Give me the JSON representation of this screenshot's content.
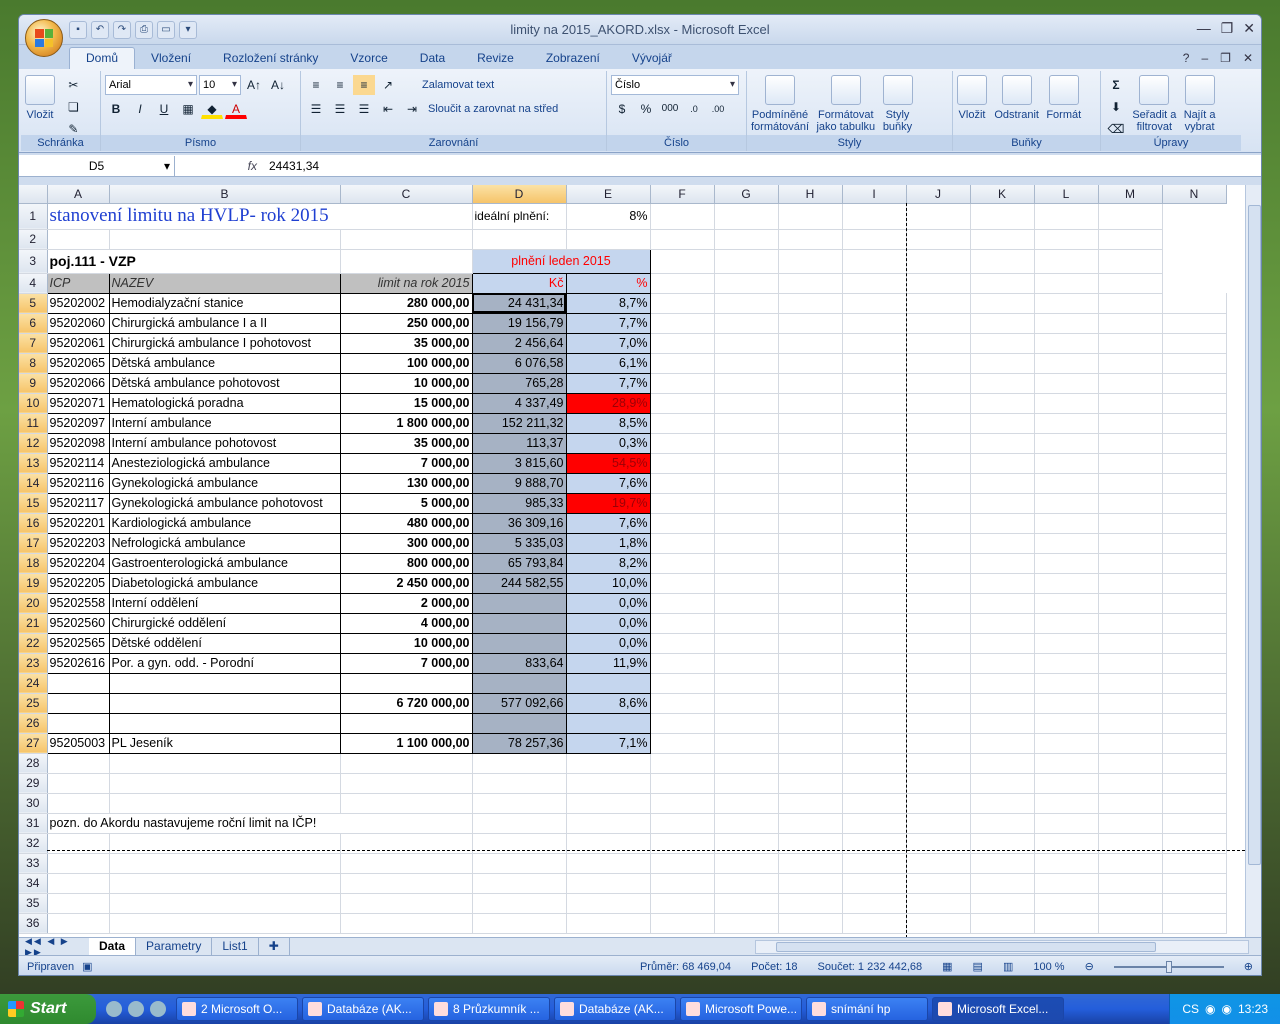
{
  "window": {
    "title": "limity na 2015_AKORD.xlsx - Microsoft Excel"
  },
  "ribbon_tabs": [
    "Domů",
    "Vložení",
    "Rozložení stránky",
    "Vzorce",
    "Data",
    "Revize",
    "Zobrazení",
    "Vývojář"
  ],
  "ribbon": {
    "clipboard": {
      "paste": "Vložit",
      "label": "Schránka"
    },
    "font": {
      "name": "Arial",
      "size": "10",
      "label": "Písmo",
      "bold": "B",
      "italic": "I",
      "underline": "U"
    },
    "alignment": {
      "wrap": "Zalamovat text",
      "merge": "Sloučit a zarovnat na střed",
      "label": "Zarovnání"
    },
    "number": {
      "format": "Číslo",
      "percent": "%",
      "thousands": "000",
      "label": "Číslo"
    },
    "styles": {
      "conditional_1": "Podmíněné",
      "conditional_2": "formátování",
      "table_1": "Formátovat",
      "table_2": "jako tabulku",
      "cell_1": "Styly",
      "cell_2": "buňky",
      "label": "Styly"
    },
    "cells": {
      "insert": "Vložit",
      "delete": "Odstranit",
      "format": "Formát",
      "label": "Buňky"
    },
    "editing": {
      "sort_1": "Seřadit a",
      "sort_2": "filtrovat",
      "find_1": "Najít a",
      "find_2": "vybrat",
      "sigma": "Σ",
      "label": "Úpravy"
    }
  },
  "formula_bar": {
    "name_box": "D5",
    "fx": "fx",
    "value": "24431,34"
  },
  "columns": [
    "A",
    "B",
    "C",
    "D",
    "E",
    "F",
    "G",
    "H",
    "I",
    "J",
    "K",
    "L",
    "M",
    "N"
  ],
  "sheet": {
    "title": "stanovení limitu na HVLP- rok 2015",
    "ideal_label": "ideální plnění:",
    "ideal_value": "8%",
    "section": "poj.111 - VZP",
    "period_header": "plnění leden 2015",
    "hdr_icp": "ICP",
    "hdr_nazev": "NAZEV",
    "hdr_limit": "limit na rok 2015",
    "hdr_kc": "Kč",
    "hdr_pct": "%",
    "rows": [
      {
        "r": "5",
        "icp": "95202002",
        "name": "Hemodialyzační stanice",
        "limit": "280 000,00",
        "kc": "24 431,34",
        "pct": "8,7%",
        "red": false
      },
      {
        "r": "6",
        "icp": "95202060",
        "name": "Chirurgická ambulance I a II",
        "limit": "250 000,00",
        "kc": "19 156,79",
        "pct": "7,7%",
        "red": false
      },
      {
        "r": "7",
        "icp": "95202061",
        "name": "Chirurgická ambulance I pohotovost",
        "limit": "35 000,00",
        "kc": "2 456,64",
        "pct": "7,0%",
        "red": false
      },
      {
        "r": "8",
        "icp": "95202065",
        "name": "Dětská ambulance",
        "limit": "100 000,00",
        "kc": "6 076,58",
        "pct": "6,1%",
        "red": false
      },
      {
        "r": "9",
        "icp": "95202066",
        "name": "Dětská ambulance pohotovost",
        "limit": "10 000,00",
        "kc": "765,28",
        "pct": "7,7%",
        "red": false
      },
      {
        "r": "10",
        "icp": "95202071",
        "name": "Hematologická poradna",
        "limit": "15 000,00",
        "kc": "4 337,49",
        "pct": "28,9%",
        "red": true
      },
      {
        "r": "11",
        "icp": "95202097",
        "name": "Interní ambulance",
        "limit": "1 800 000,00",
        "kc": "152 211,32",
        "pct": "8,5%",
        "red": false
      },
      {
        "r": "12",
        "icp": "95202098",
        "name": "Interní ambulance pohotovost",
        "limit": "35 000,00",
        "kc": "113,37",
        "pct": "0,3%",
        "red": false
      },
      {
        "r": "13",
        "icp": "95202114",
        "name": "Anesteziologická ambulance",
        "limit": "7 000,00",
        "kc": "3 815,60",
        "pct": "54,5%",
        "red": true
      },
      {
        "r": "14",
        "icp": "95202116",
        "name": "Gynekologická ambulance",
        "limit": "130 000,00",
        "kc": "9 888,70",
        "pct": "7,6%",
        "red": false
      },
      {
        "r": "15",
        "icp": "95202117",
        "name": "Gynekologická ambulance pohotovost",
        "limit": "5 000,00",
        "kc": "985,33",
        "pct": "19,7%",
        "red": true
      },
      {
        "r": "16",
        "icp": "95202201",
        "name": "Kardiologická ambulance",
        "limit": "480 000,00",
        "kc": "36 309,16",
        "pct": "7,6%",
        "red": false
      },
      {
        "r": "17",
        "icp": "95202203",
        "name": "Nefrologická ambulance",
        "limit": "300 000,00",
        "kc": "5 335,03",
        "pct": "1,8%",
        "red": false
      },
      {
        "r": "18",
        "icp": "95202204",
        "name": "Gastroenterologická ambulance",
        "limit": "800 000,00",
        "kc": "65 793,84",
        "pct": "8,2%",
        "red": false
      },
      {
        "r": "19",
        "icp": "95202205",
        "name": "Diabetologická ambulance",
        "limit": "2 450 000,00",
        "kc": "244 582,55",
        "pct": "10,0%",
        "red": false
      },
      {
        "r": "20",
        "icp": "95202558",
        "name": "Interní oddělení",
        "limit": "2 000,00",
        "kc": "",
        "pct": "0,0%",
        "red": false
      },
      {
        "r": "21",
        "icp": "95202560",
        "name": "Chirurgické oddělení",
        "limit": "4 000,00",
        "kc": "",
        "pct": "0,0%",
        "red": false
      },
      {
        "r": "22",
        "icp": "95202565",
        "name": "Dětské oddělení",
        "limit": "10 000,00",
        "kc": "",
        "pct": "0,0%",
        "red": false
      },
      {
        "r": "23",
        "icp": "95202616",
        "name": "Por. a gyn. odd. - Porodní",
        "limit": "7 000,00",
        "kc": "833,64",
        "pct": "11,9%",
        "red": false
      }
    ],
    "total": {
      "limit": "6 720 000,00",
      "kc": "577 092,66",
      "pct": "8,6%"
    },
    "jesenik": {
      "icp": "95205003",
      "name": "PL Jeseník",
      "limit": "1 100 000,00",
      "kc": "78 257,36",
      "pct": "7,1%"
    },
    "note": "pozn. do Akordu nastavujeme roční limit na IČP!"
  },
  "sheet_tabs": [
    "Data",
    "Parametry",
    "List1"
  ],
  "statusbar": {
    "ready": "Připraven",
    "avg": "Průměr: 68 469,04",
    "count": "Počet: 18",
    "sum": "Součet: 1 232 442,68",
    "zoom": "100 %"
  },
  "taskbar": {
    "start": "Start",
    "tasks": [
      "2 Microsoft O...",
      "Databáze (AK...",
      "8 Průzkumník ...",
      "Databáze (AK...",
      "Microsoft Powe...",
      "snímání hp",
      "Microsoft Excel..."
    ],
    "lang": "CS",
    "clock": "13:23"
  }
}
